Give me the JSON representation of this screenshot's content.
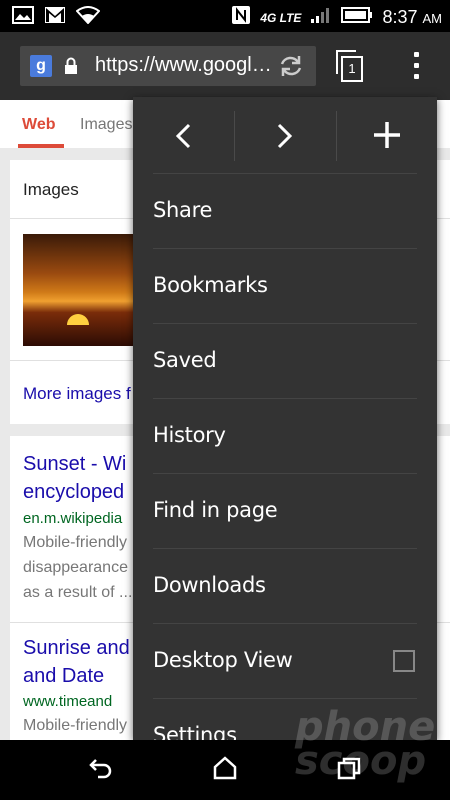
{
  "status_bar": {
    "network": "4G LTE",
    "time": "8:37",
    "ampm": "AM"
  },
  "browser": {
    "url": "https://www.googl…",
    "tab_count": "1"
  },
  "page": {
    "tabs": [
      {
        "label": "Web"
      },
      {
        "label": "Images"
      }
    ],
    "images_card": {
      "header": "Images",
      "more_link": "More images f"
    },
    "results": [
      {
        "title_line1": "Sunset - Wi",
        "title_line2": "encycloped",
        "url": "en.m.wikipedia",
        "snippet_line1": "Mobile-friendly",
        "snippet_line2": "disappearance",
        "snippet_line3": "as a result of ..."
      },
      {
        "title_line1": "Sunrise and",
        "title_line2": "and Date",
        "url": "www.timeand",
        "snippet_line1": "Mobile-friendly"
      }
    ]
  },
  "menu": {
    "items": [
      {
        "label": "Share"
      },
      {
        "label": "Bookmarks"
      },
      {
        "label": "Saved"
      },
      {
        "label": "History"
      },
      {
        "label": "Find in page"
      },
      {
        "label": "Downloads"
      },
      {
        "label": "Desktop View",
        "checked": false
      },
      {
        "label": "Settings"
      }
    ]
  },
  "watermark": {
    "line1": "phone",
    "line2": "scoop"
  },
  "icons": [
    "image-icon",
    "gmail-icon",
    "wifi-icon",
    "nfc-icon",
    "signal-icon",
    "battery-icon",
    "google-icon",
    "lock-icon",
    "reload-icon",
    "tabs-icon",
    "overflow-icon",
    "back-arrow-icon",
    "forward-arrow-icon",
    "new-tab-icon",
    "checkbox-icon",
    "back-icon",
    "home-icon",
    "recents-icon"
  ]
}
